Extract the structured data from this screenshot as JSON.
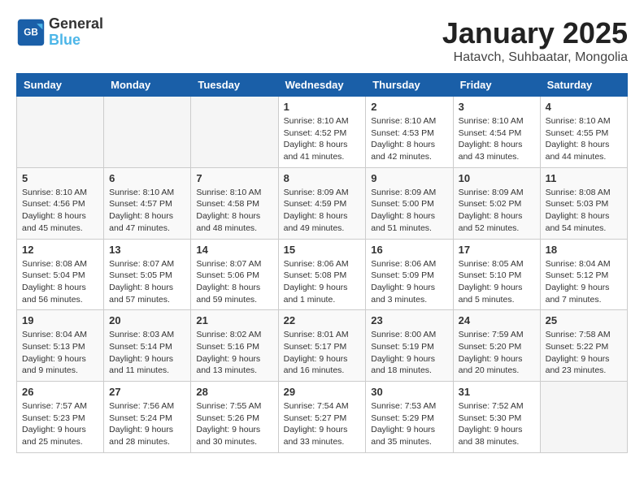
{
  "logo": {
    "line1": "General",
    "line2": "Blue"
  },
  "title": "January 2025",
  "location": "Hatavch, Suhbaatar, Mongolia",
  "days_of_week": [
    "Sunday",
    "Monday",
    "Tuesday",
    "Wednesday",
    "Thursday",
    "Friday",
    "Saturday"
  ],
  "weeks": [
    [
      {
        "day": "",
        "info": ""
      },
      {
        "day": "",
        "info": ""
      },
      {
        "day": "",
        "info": ""
      },
      {
        "day": "1",
        "info": "Sunrise: 8:10 AM\nSunset: 4:52 PM\nDaylight: 8 hours\nand 41 minutes."
      },
      {
        "day": "2",
        "info": "Sunrise: 8:10 AM\nSunset: 4:53 PM\nDaylight: 8 hours\nand 42 minutes."
      },
      {
        "day": "3",
        "info": "Sunrise: 8:10 AM\nSunset: 4:54 PM\nDaylight: 8 hours\nand 43 minutes."
      },
      {
        "day": "4",
        "info": "Sunrise: 8:10 AM\nSunset: 4:55 PM\nDaylight: 8 hours\nand 44 minutes."
      }
    ],
    [
      {
        "day": "5",
        "info": "Sunrise: 8:10 AM\nSunset: 4:56 PM\nDaylight: 8 hours\nand 45 minutes."
      },
      {
        "day": "6",
        "info": "Sunrise: 8:10 AM\nSunset: 4:57 PM\nDaylight: 8 hours\nand 47 minutes."
      },
      {
        "day": "7",
        "info": "Sunrise: 8:10 AM\nSunset: 4:58 PM\nDaylight: 8 hours\nand 48 minutes."
      },
      {
        "day": "8",
        "info": "Sunrise: 8:09 AM\nSunset: 4:59 PM\nDaylight: 8 hours\nand 49 minutes."
      },
      {
        "day": "9",
        "info": "Sunrise: 8:09 AM\nSunset: 5:00 PM\nDaylight: 8 hours\nand 51 minutes."
      },
      {
        "day": "10",
        "info": "Sunrise: 8:09 AM\nSunset: 5:02 PM\nDaylight: 8 hours\nand 52 minutes."
      },
      {
        "day": "11",
        "info": "Sunrise: 8:08 AM\nSunset: 5:03 PM\nDaylight: 8 hours\nand 54 minutes."
      }
    ],
    [
      {
        "day": "12",
        "info": "Sunrise: 8:08 AM\nSunset: 5:04 PM\nDaylight: 8 hours\nand 56 minutes."
      },
      {
        "day": "13",
        "info": "Sunrise: 8:07 AM\nSunset: 5:05 PM\nDaylight: 8 hours\nand 57 minutes."
      },
      {
        "day": "14",
        "info": "Sunrise: 8:07 AM\nSunset: 5:06 PM\nDaylight: 8 hours\nand 59 minutes."
      },
      {
        "day": "15",
        "info": "Sunrise: 8:06 AM\nSunset: 5:08 PM\nDaylight: 9 hours\nand 1 minute."
      },
      {
        "day": "16",
        "info": "Sunrise: 8:06 AM\nSunset: 5:09 PM\nDaylight: 9 hours\nand 3 minutes."
      },
      {
        "day": "17",
        "info": "Sunrise: 8:05 AM\nSunset: 5:10 PM\nDaylight: 9 hours\nand 5 minutes."
      },
      {
        "day": "18",
        "info": "Sunrise: 8:04 AM\nSunset: 5:12 PM\nDaylight: 9 hours\nand 7 minutes."
      }
    ],
    [
      {
        "day": "19",
        "info": "Sunrise: 8:04 AM\nSunset: 5:13 PM\nDaylight: 9 hours\nand 9 minutes."
      },
      {
        "day": "20",
        "info": "Sunrise: 8:03 AM\nSunset: 5:14 PM\nDaylight: 9 hours\nand 11 minutes."
      },
      {
        "day": "21",
        "info": "Sunrise: 8:02 AM\nSunset: 5:16 PM\nDaylight: 9 hours\nand 13 minutes."
      },
      {
        "day": "22",
        "info": "Sunrise: 8:01 AM\nSunset: 5:17 PM\nDaylight: 9 hours\nand 16 minutes."
      },
      {
        "day": "23",
        "info": "Sunrise: 8:00 AM\nSunset: 5:19 PM\nDaylight: 9 hours\nand 18 minutes."
      },
      {
        "day": "24",
        "info": "Sunrise: 7:59 AM\nSunset: 5:20 PM\nDaylight: 9 hours\nand 20 minutes."
      },
      {
        "day": "25",
        "info": "Sunrise: 7:58 AM\nSunset: 5:22 PM\nDaylight: 9 hours\nand 23 minutes."
      }
    ],
    [
      {
        "day": "26",
        "info": "Sunrise: 7:57 AM\nSunset: 5:23 PM\nDaylight: 9 hours\nand 25 minutes."
      },
      {
        "day": "27",
        "info": "Sunrise: 7:56 AM\nSunset: 5:24 PM\nDaylight: 9 hours\nand 28 minutes."
      },
      {
        "day": "28",
        "info": "Sunrise: 7:55 AM\nSunset: 5:26 PM\nDaylight: 9 hours\nand 30 minutes."
      },
      {
        "day": "29",
        "info": "Sunrise: 7:54 AM\nSunset: 5:27 PM\nDaylight: 9 hours\nand 33 minutes."
      },
      {
        "day": "30",
        "info": "Sunrise: 7:53 AM\nSunset: 5:29 PM\nDaylight: 9 hours\nand 35 minutes."
      },
      {
        "day": "31",
        "info": "Sunrise: 7:52 AM\nSunset: 5:30 PM\nDaylight: 9 hours\nand 38 minutes."
      },
      {
        "day": "",
        "info": ""
      }
    ]
  ]
}
